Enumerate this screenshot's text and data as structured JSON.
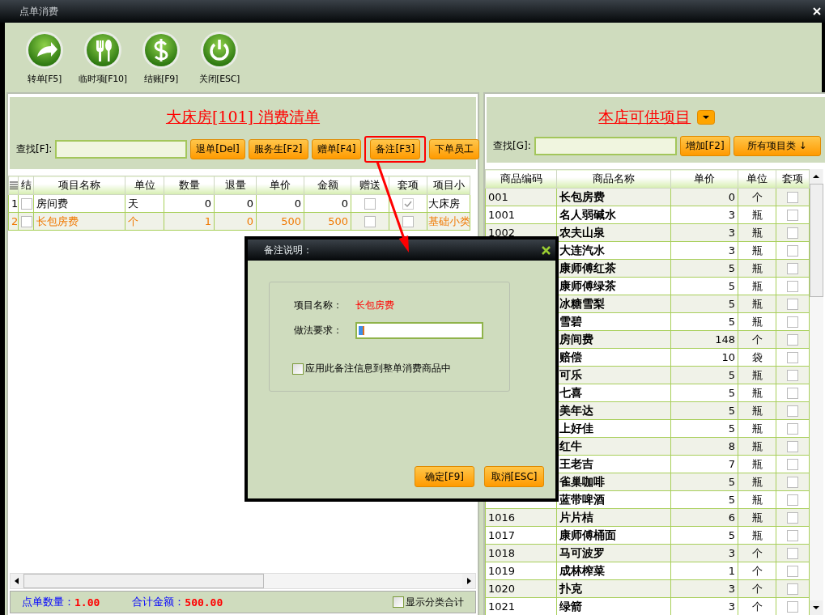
{
  "window": {
    "title": "点单消费"
  },
  "toolbar": [
    {
      "label": "转单[F5]",
      "kind": "forward"
    },
    {
      "label": "临时项[F10]",
      "kind": "cutlery"
    },
    {
      "label": "结账[F9]",
      "kind": "dollar"
    },
    {
      "label": "关闭[ESC]",
      "kind": "power"
    }
  ],
  "order_panel": {
    "title": "大床房[101]  消费清单",
    "search_label": "查找[F]:",
    "buttons": [
      {
        "label": "退单[Del]",
        "highlighted": false
      },
      {
        "label": "服务生[F2]",
        "highlighted": false
      },
      {
        "label": "赠单[F4]",
        "highlighted": false
      },
      {
        "label": "备注[F3]",
        "highlighted": true
      },
      {
        "label": "下单员工",
        "highlighted": false
      }
    ],
    "columns": [
      "结",
      "项目名称",
      "单位",
      "数量",
      "退量",
      "单价",
      "金额",
      "赠送",
      "套项",
      "项目小"
    ],
    "rows": [
      {
        "index": "1",
        "settled": false,
        "name": "房间费",
        "unit": "天",
        "qty": "0",
        "returned": "0",
        "price": "0",
        "amount": "0",
        "gift": false,
        "package": true,
        "category": "大床房",
        "selected": false
      },
      {
        "index": "2",
        "settled": false,
        "name": "长包房费",
        "unit": "个",
        "qty": "1",
        "returned": "0",
        "price": "500",
        "amount": "500",
        "gift": false,
        "package": false,
        "category": "基础小类",
        "selected": true
      }
    ],
    "footer": {
      "count_label": "点单数量：",
      "count": "1.00",
      "total_label": "合计金额：",
      "total": "500.00",
      "category_total": {
        "label": "显示分类合计",
        "checked": false
      }
    }
  },
  "catalog_panel": {
    "title": "本店可供项目",
    "search_label": "查找[G]:",
    "buttons": [
      "增加[F2]",
      "所有项目类 ↓"
    ],
    "columns": [
      "商品编码",
      "商品名称",
      "单价",
      "单位",
      "套项"
    ],
    "rows": [
      {
        "code": "001",
        "name": "长包房费",
        "price": "0",
        "unit": "个",
        "package": false
      },
      {
        "code": "1001",
        "name": "名人弱碱水",
        "price": "3",
        "unit": "瓶",
        "package": false
      },
      {
        "code": "1002",
        "name": "农夫山泉",
        "price": "3",
        "unit": "瓶",
        "package": false
      },
      {
        "name": "大连汽水",
        "price": "3",
        "unit": "瓶",
        "package": false
      },
      {
        "name": "康师傅红茶",
        "price": "5",
        "unit": "瓶",
        "package": false
      },
      {
        "name": "康师傅绿茶",
        "price": "5",
        "unit": "瓶",
        "package": false
      },
      {
        "name": "冰糖雪梨",
        "price": "5",
        "unit": "瓶",
        "package": false
      },
      {
        "name": "雪碧",
        "price": "5",
        "unit": "瓶",
        "package": false
      },
      {
        "name": "房间费",
        "price": "148",
        "unit": "个",
        "package": false
      },
      {
        "name": "赔偿",
        "price": "10",
        "unit": "袋",
        "package": false
      },
      {
        "name": "可乐",
        "price": "5",
        "unit": "瓶",
        "package": false
      },
      {
        "name": "七喜",
        "price": "5",
        "unit": "瓶",
        "package": false
      },
      {
        "name": "美年达",
        "price": "5",
        "unit": "瓶",
        "package": false
      },
      {
        "name": "上好佳",
        "price": "5",
        "unit": "瓶",
        "package": false
      },
      {
        "name": "红牛",
        "price": "8",
        "unit": "瓶",
        "package": false
      },
      {
        "name": "王老吉",
        "price": "7",
        "unit": "瓶",
        "package": false
      },
      {
        "name": "雀巢咖啡",
        "price": "5",
        "unit": "瓶",
        "package": false
      },
      {
        "name": "蓝带啤酒",
        "price": "5",
        "unit": "瓶",
        "package": false
      },
      {
        "code": "1016",
        "name": "片片桔",
        "price": "6",
        "unit": "瓶",
        "package": false
      },
      {
        "code": "1017",
        "name": "康师傅桶面",
        "price": "5",
        "unit": "瓶",
        "package": false
      },
      {
        "code": "1018",
        "name": "马可波罗",
        "price": "3",
        "unit": "个",
        "package": false
      },
      {
        "code": "1019",
        "name": "成林榨菜",
        "price": "1",
        "unit": "个",
        "package": false
      },
      {
        "code": "1020",
        "name": "扑克",
        "price": "3",
        "unit": "个",
        "package": false
      },
      {
        "code": "1021",
        "name": "绿箭",
        "price": "3",
        "unit": "个",
        "package": false
      }
    ]
  },
  "dialog": {
    "title": "备注说明：",
    "item_label": "项目名称：",
    "item_name": "长包房费",
    "method_label": "做法要求：",
    "apply_all": {
      "label": "应用此备注信息到整单消费商品中",
      "checked": false
    },
    "buttons": [
      "确定[F9]",
      "取消[ESC]"
    ]
  }
}
